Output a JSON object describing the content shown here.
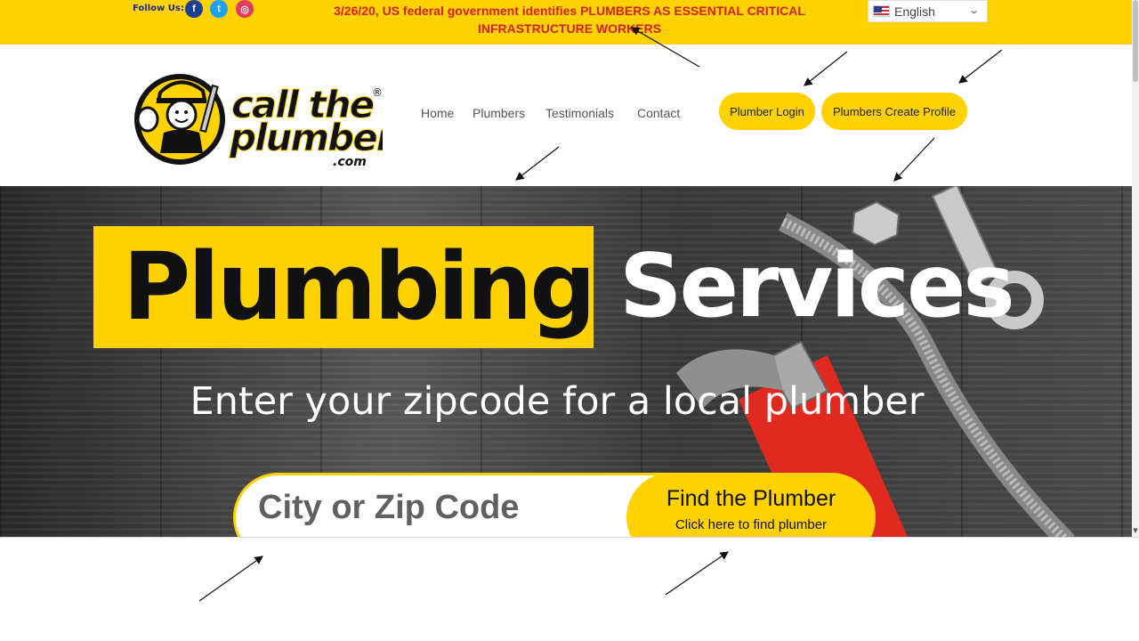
{
  "topbar": {
    "follow_label": "Follow Us:",
    "social": [
      {
        "icon": "facebook-icon",
        "glyph": "f"
      },
      {
        "icon": "twitter-icon",
        "glyph": "t"
      },
      {
        "icon": "instagram-icon",
        "glyph": "◎"
      }
    ],
    "announcement": "3/26/20, US federal government identifies PLUMBERS AS ESSENTIAL CRITICAL INFRASTRUCTURE WORKERS",
    "language": {
      "selected": "English",
      "flag_icon": "us-flag-icon"
    }
  },
  "header": {
    "logo": {
      "line1": "call the",
      "line2": "plumber",
      "line3": ".com",
      "registered": "®"
    },
    "nav": [
      "Home",
      "Plumbers",
      "Testimonials",
      "Contact"
    ],
    "plumber_login": "Plumber Login",
    "create_profile": "Plumbers Create Profile"
  },
  "hero": {
    "word1": "Plumbing",
    "word2": "Services",
    "subtitle": "Enter your zipcode for a local plumber",
    "search_placeholder": "City or Zip Code",
    "find_button_title": "Find the Plumber",
    "find_button_sub": "Click here to find plumber"
  },
  "colors": {
    "brand_yellow": "#ffd200",
    "announcement_red": "#d3221c",
    "text_dark": "#111111"
  }
}
